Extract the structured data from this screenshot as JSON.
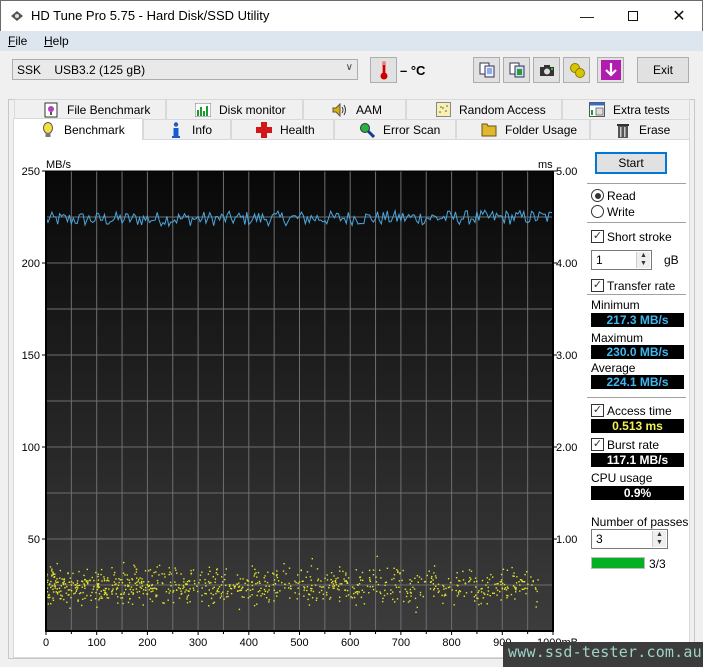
{
  "window": {
    "title": "HD Tune Pro 5.75 - Hard Disk/SSD Utility",
    "controls": [
      "minimize",
      "maximize",
      "close"
    ]
  },
  "menu": {
    "items": [
      {
        "label": "File",
        "accel": "F",
        "rest": "ile"
      },
      {
        "label": "Help",
        "accel": "H",
        "rest": "elp"
      }
    ]
  },
  "toolbar": {
    "drive": "SSK    USB3.2 (125 gB)",
    "temperature": "– °C",
    "buttons": [
      "copy-text-icon",
      "copy-image-icon",
      "screenshot-icon",
      "options-icon",
      "save-download-icon"
    ],
    "exit_label": "Exit"
  },
  "tabs": {
    "row1": [
      {
        "label": "File Benchmark",
        "icon": "file-benchmark-icon"
      },
      {
        "label": "Disk monitor",
        "icon": "disk-monitor-icon"
      },
      {
        "label": "AAM",
        "icon": "speaker-icon"
      },
      {
        "label": "Random Access",
        "icon": "random-access-icon"
      },
      {
        "label": "Extra tests",
        "icon": "extra-tests-icon"
      }
    ],
    "row2": [
      {
        "label": "Benchmark",
        "icon": "lightbulb-icon",
        "active": true
      },
      {
        "label": "Info",
        "icon": "info-icon"
      },
      {
        "label": "Health",
        "icon": "health-cross-icon"
      },
      {
        "label": "Error Scan",
        "icon": "magnifier-icon"
      },
      {
        "label": "Folder Usage",
        "icon": "folder-icon"
      },
      {
        "label": "Erase",
        "icon": "trash-icon"
      }
    ]
  },
  "controls": {
    "start_label": "Start",
    "mode": {
      "read": "Read",
      "write": "Write",
      "selected": "Read"
    },
    "short_stroke": {
      "label": "Short stroke",
      "checked": true,
      "value": "1",
      "unit": "gB"
    },
    "transfer_rate": {
      "label": "Transfer rate",
      "checked": true
    },
    "minimum": {
      "label": "Minimum",
      "value": "217.3 MB/s"
    },
    "maximum": {
      "label": "Maximum",
      "value": "230.0 MB/s"
    },
    "average": {
      "label": "Average",
      "value": "224.1 MB/s"
    },
    "access_time": {
      "label": "Access time",
      "checked": true,
      "value": "0.513 ms"
    },
    "burst_rate": {
      "label": "Burst rate",
      "checked": true,
      "value": "117.1 MB/s"
    },
    "cpu_usage": {
      "label": "CPU usage",
      "value": "0.9%"
    },
    "passes": {
      "label": "Number of passes",
      "value": "3",
      "progress_text": "3/3",
      "progress": 1.0
    }
  },
  "colors": {
    "transfer_line": "#4aa8e0",
    "access_dots": "#e6e62a",
    "stat_blue": "#3fb6f0",
    "access_yellow": "#f2f25a",
    "progress_green": "#06b025"
  },
  "watermark": "www.ssd-tester.com.au",
  "chart_data": {
    "type": "line",
    "title": "",
    "xlabel": "mB",
    "ylabel_left": "MB/s",
    "ylabel_right": "ms",
    "x_range": [
      0,
      1000
    ],
    "y_left_range": [
      0,
      250
    ],
    "y_right_range": [
      0,
      5
    ],
    "x_ticks": [
      "0",
      "100",
      "200",
      "300",
      "400",
      "500",
      "600",
      "700",
      "800",
      "900",
      "1000mB"
    ],
    "y_left_ticks": [
      "50",
      "100",
      "150",
      "200",
      "250"
    ],
    "y_right_ticks": [
      "1.00",
      "2.00",
      "3.00",
      "4.00",
      "5.00"
    ],
    "grid": true,
    "series": [
      {
        "name": "Transfer rate (MB/s)",
        "axis": "left",
        "kind": "line",
        "min": 217.3,
        "max": 230.0,
        "average": 224.1
      },
      {
        "name": "Access time (ms)",
        "axis": "right",
        "kind": "scatter",
        "average": 0.513,
        "spread": [
          0.2,
          0.85
        ],
        "x_extent": [
          0,
          970
        ]
      }
    ]
  }
}
